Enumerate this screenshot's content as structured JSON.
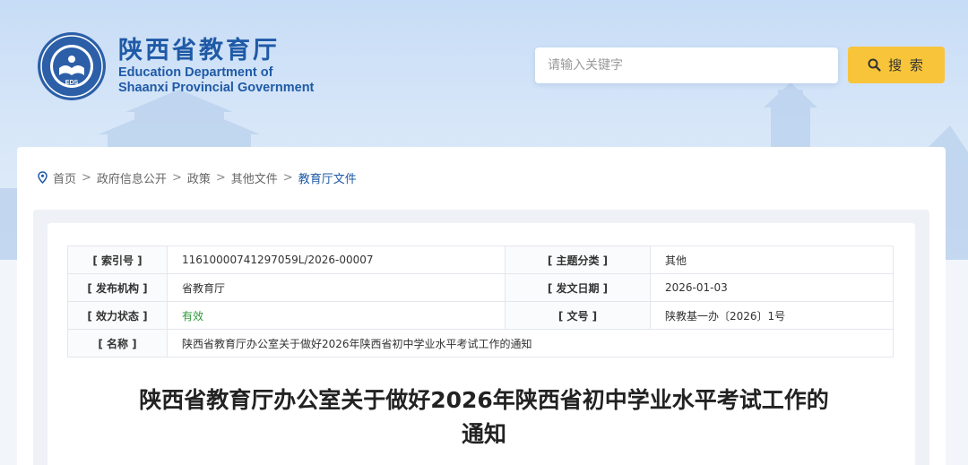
{
  "site": {
    "title_cn": "陕西省教育厅",
    "title_en_1": "Education Department of",
    "title_en_2": "Shaanxi Provincial Government",
    "seal_text": "EDS",
    "brand_color": "#1f5aa6",
    "accent_color": "#f8c43a"
  },
  "search": {
    "placeholder": "请输入关键字",
    "value": "",
    "button_label": "搜 索",
    "button_icon": "search-icon"
  },
  "breadcrumb": {
    "icon": "location-pin-icon",
    "items": [
      "首页",
      "政府信息公开",
      "政策",
      "其他文件",
      "教育厅文件"
    ],
    "separator": ">"
  },
  "meta": {
    "index_label": "[ 索引号 ]",
    "index_value": "11610000741297059L/2026-00007",
    "topic_label": "[ 主题分类 ]",
    "topic_value": "其他",
    "publisher_label": "[ 发布机构 ]",
    "publisher_value": "省教育厅",
    "date_label": "[ 发文日期 ]",
    "date_value": "2026-01-03",
    "status_label": "[ 效力状态 ]",
    "status_value": "有效",
    "status_color": "#2f9a3a",
    "docno_label": "[ 文号 ]",
    "docno_value": "陕教基一办〔2026〕1号",
    "name_label": "[ 名称 ]",
    "name_value": "陕西省教育厅办公室关于做好2026年陕西省初中学业水平考试工作的通知"
  },
  "document": {
    "title_line1": "陕西省教育厅办公室关于做好2026年陕西省初中学业水平考试工作的",
    "title_line2": "通知"
  }
}
